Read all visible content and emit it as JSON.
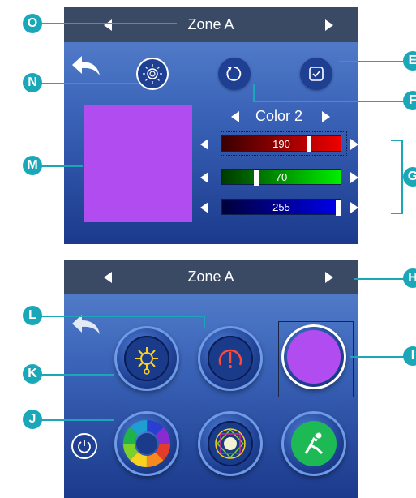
{
  "screen_top": {
    "header": {
      "title": "Zone A"
    },
    "color_selector": {
      "label": "Color 2"
    },
    "swatch_color": "#b14cf1",
    "sliders": [
      {
        "name": "red",
        "value": "190",
        "fraction": 0.745
      },
      {
        "name": "green",
        "value": "70",
        "fraction": 0.275
      },
      {
        "name": "blue",
        "value": "255",
        "fraction": 1.0
      }
    ]
  },
  "screen_bottom": {
    "header": {
      "title": "Zone A"
    },
    "selected_color": "#b14cf1"
  },
  "callouts": {
    "O": "O",
    "N": "N",
    "M": "M",
    "E": "E",
    "F": "F",
    "G": "G",
    "H": "H",
    "L": "L",
    "K": "K",
    "J": "J",
    "I": "I"
  },
  "colors": {
    "accent": "#1aa8b8",
    "header_bg": "#3a4a64",
    "red_track": "#cc0000",
    "green_track": "#00cc00",
    "blue_track": "#0000cc"
  }
}
